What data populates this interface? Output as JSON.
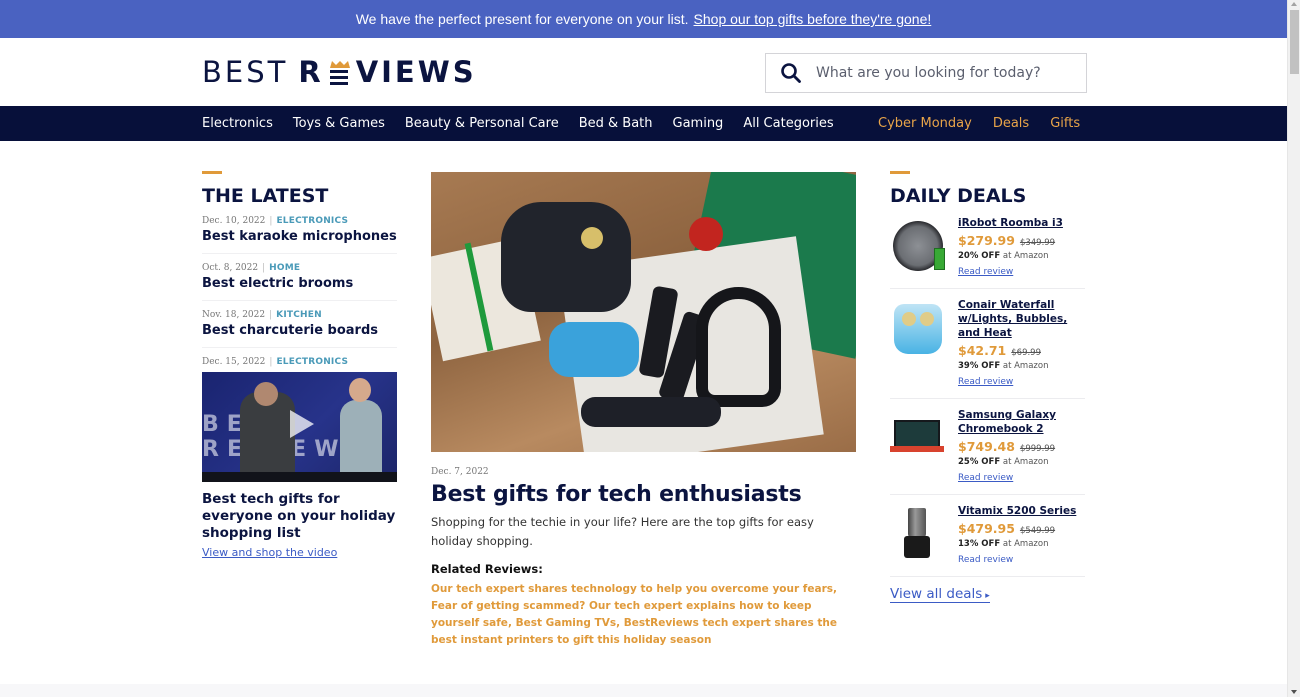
{
  "promo": {
    "text": "We have the perfect present for everyone on your list.",
    "link": "Shop our top gifts before they're gone!"
  },
  "header": {
    "logo_part1": "BEST",
    "logo_part2_r": "R",
    "logo_part3": "VIEWS",
    "search_placeholder": "What are you looking for today?",
    "search_icon": "search-icon"
  },
  "nav": {
    "left": [
      "Electronics",
      "Toys & Games",
      "Beauty & Personal Care",
      "Bed & Bath",
      "Gaming",
      "All Categories"
    ],
    "right": [
      "Cyber Monday",
      "Deals",
      "Gifts"
    ],
    "accent_color": "#e8a449"
  },
  "latest": {
    "title": "THE LATEST",
    "items": [
      {
        "date": "Dec. 10, 2022",
        "category": "ELECTRONICS",
        "title": "Best karaoke microphones"
      },
      {
        "date": "Oct. 8, 2022",
        "category": "HOME",
        "title": "Best electric brooms"
      },
      {
        "date": "Nov. 18, 2022",
        "category": "KITCHEN",
        "title": "Best charcuterie boards"
      }
    ],
    "video": {
      "date": "Dec. 15, 2022",
      "category": "ELECTRONICS",
      "thumb_text": "BEST REVIEWS",
      "title": "Best tech gifts for everyone on your holiday shopping list",
      "link": "View and shop the video"
    }
  },
  "feature": {
    "date": "Dec. 7, 2022",
    "title": "Best gifts for tech enthusiasts",
    "description": "Shopping for the techie in your life? Here are the top gifts for easy holiday shopping.",
    "related_label": "Related Reviews:",
    "related": [
      "Our tech expert shares technology to help you overcome your fears",
      "Fear of getting scammed? Our tech expert explains how to keep yourself safe",
      "Best Gaming TVs",
      "BestReviews tech expert shares the best instant printers to gift this holiday season"
    ]
  },
  "deals": {
    "title": "DAILY DEALS",
    "items": [
      {
        "name": "iRobot Roomba i3",
        "price": "$279.99",
        "original": "$349.99",
        "off": "20% OFF",
        "store": "at Amazon",
        "review": "Read review"
      },
      {
        "name": "Conair Waterfall w/Lights, Bubbles, and Heat",
        "price": "$42.71",
        "original": "$69.99",
        "off": "39% OFF",
        "store": "at Amazon",
        "review": "Read review"
      },
      {
        "name": "Samsung Galaxy Chromebook 2",
        "price": "$749.48",
        "original": "$999.99",
        "off": "25% OFF",
        "store": "at Amazon",
        "review": "Read review"
      },
      {
        "name": "Vitamix 5200 Series",
        "price": "$479.95",
        "original": "$549.99",
        "off": "13% OFF",
        "store": "at Amazon",
        "review": "Read review"
      }
    ],
    "view_all": "View all deals",
    "price_color": "#e09a3a",
    "link_color": "#3b5bc5"
  },
  "colors": {
    "promo_bg": "#4a62c1",
    "nav_bg": "#07103a",
    "navy": "#0b1440",
    "accent": "#e09a3a",
    "category": "#4a9ab8"
  }
}
